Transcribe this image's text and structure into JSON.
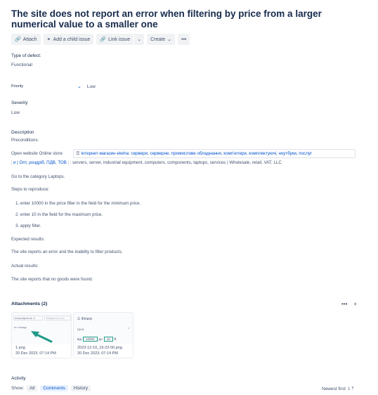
{
  "issue": {
    "title": "The site does not report an error when filtering by price from a larger numerical value to a smaller one"
  },
  "toolbar": {
    "attach": "Attach",
    "add_child": "Add a child issue",
    "link_issue": "Link issue",
    "create": "Create",
    "more": "•••"
  },
  "fields": {
    "defect_label": "Type of defect:",
    "defect_value": "Functional",
    "priority_label": "Priority",
    "priority_value": "Low",
    "severity_label": "Severity",
    "severity_value": "Low"
  },
  "description": {
    "label": "Description",
    "preconditions": "Preconditions:",
    "open_text": "Open website Online store",
    "link_card": "Інтернет-магазин ekeha: сервери, серверне, промислове обладнання, комп'ютери, комплектуючі, ноутбуки, послуг",
    "line2_link": "и | Опт, роздріб, ПДВ, ТОВ",
    "line2_rest": ": servers, server, industrial equipment, computers, components, laptops, services | Wholesale, retail, VAT, LLC",
    "go_to": "Go to the category Laptops.",
    "steps_label": "Steps to reproduce:",
    "steps": [
      "1. enter 10000 in the price filter in the field for the minimum price.",
      "2. enter 10 in the field for the maximum price.",
      "3. apply filter."
    ],
    "expected_label": "Expected results:",
    "expected": "The site reports an error and the inability to filter products.",
    "actual_label": "Actual results:",
    "actual": "The site reports that no goods were found."
  },
  "attachments": {
    "title": "Attachments (2)",
    "more": "•••",
    "add": "+",
    "items": [
      {
        "file": "1.png",
        "date": "20 Dec 2023, 07:14 PM",
        "sel1": "популярністю  ∨",
        "sel2": "Товарів на сто",
        "placeholder": "по товару"
      },
      {
        "file": "2023-12-10_19-22-00.png",
        "date": "20 Dec 2023, 07:14 PM",
        "header": "Фільтр",
        "row_label": "Ціна",
        "from": "від",
        "to": "до",
        "min": "10000",
        "max": "10",
        "currency": "₴"
      }
    ]
  },
  "activity": {
    "title": "Activity",
    "show": "Show:",
    "all": "All",
    "comments": "Comments",
    "history": "History",
    "newest": "Newest first ⇂⇡"
  },
  "colors": {
    "link": "#0052cc",
    "arrow": "#1f9a8a"
  }
}
